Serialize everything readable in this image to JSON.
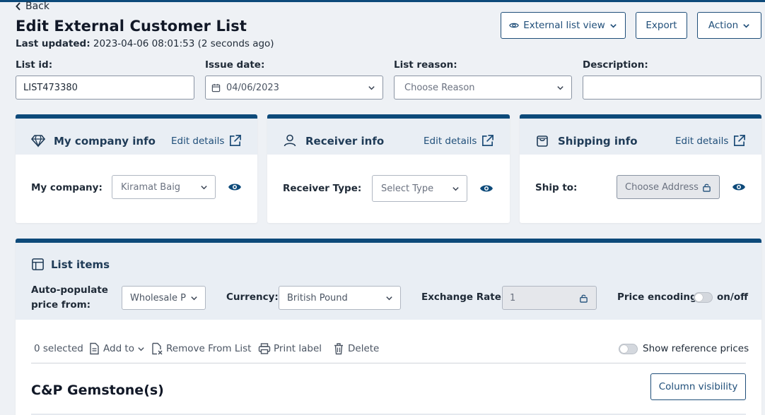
{
  "header": {
    "back_label": "Back",
    "title": "Edit External Customer List",
    "last_updated_label": "Last updated:",
    "last_updated_value": "2023-04-06 08:01:53 (2 seconds ago)",
    "external_view_label": "External list view",
    "export_label": "Export",
    "action_label": "Action"
  },
  "fields": {
    "list_id_label": "List id:",
    "list_id_value": "LIST473380",
    "issue_date_label": "Issue date:",
    "issue_date_value": "04/06/2023",
    "list_reason_label": "List reason:",
    "list_reason_placeholder": "Choose Reason",
    "description_label": "Description:",
    "description_value": ""
  },
  "company_card": {
    "title": "My company info",
    "edit_label": "Edit details",
    "row_label": "My company:",
    "select_value": "Kiramat Baig"
  },
  "receiver_card": {
    "title": "Receiver info",
    "edit_label": "Edit details",
    "row_label": "Receiver Type:",
    "select_placeholder": "Select Type"
  },
  "shipping_card": {
    "title": "Shipping info",
    "edit_label": "Edit details",
    "row_label": "Ship to:",
    "address_placeholder": "Choose Address"
  },
  "list_items": {
    "title": "List items",
    "auto_populate_label_1": "Auto-populate",
    "auto_populate_label_2": "price from:",
    "auto_populate_value": "Wholesale P",
    "currency_label": "Currency:",
    "currency_value": "British Pound",
    "exchange_rate_label": "Exchange Rate:",
    "exchange_rate_value": "1",
    "price_encoding_label": "Price encoding:",
    "price_encoding_toggle_label": "on/off",
    "selected_count": "0 selected",
    "add_to_label": "Add to",
    "remove_label": "Remove From List",
    "print_label": "Print label",
    "delete_label": "Delete",
    "show_reference_label": "Show reference prices",
    "section_title": "C&P Gemstone(s)",
    "column_visibility_label": "Column visibility"
  }
}
